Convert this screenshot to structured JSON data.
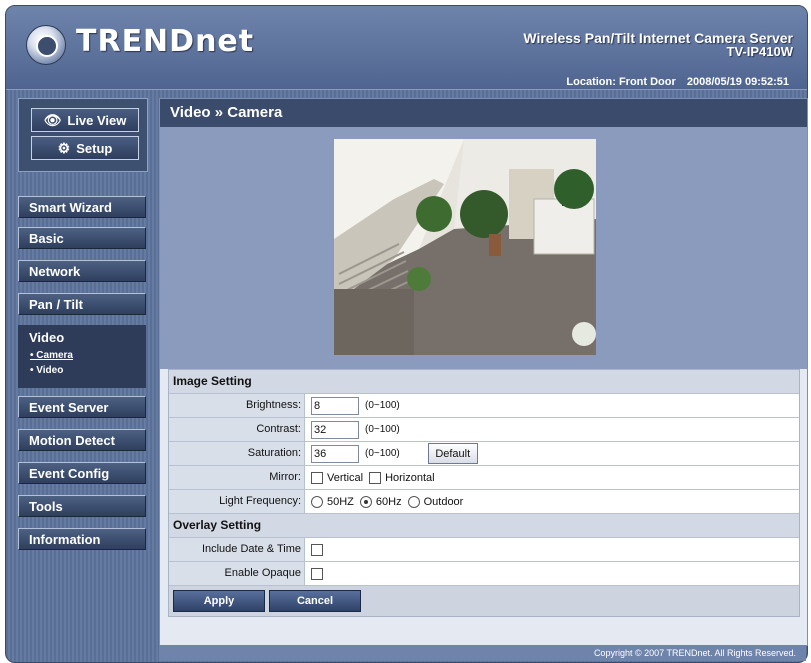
{
  "header": {
    "logo_text": "TRENDnet",
    "product_title": "Wireless Pan/Tilt Internet Camera Server",
    "product_model": "TV-IP410W",
    "location": "Location: Front Door",
    "datetime": "2008/05/19 09:52:51"
  },
  "mode": {
    "live_view": "Live View",
    "setup": "Setup"
  },
  "nav": {
    "items": [
      "Smart Wizard",
      "Basic",
      "Network",
      "Pan / Tilt",
      "Video",
      "Event Server",
      "Motion Detect",
      "Event Config",
      "Tools",
      "Information"
    ],
    "sub_items": [
      "• Camera",
      "• Video"
    ]
  },
  "main": {
    "title": "Video » Camera",
    "image_setting": {
      "header": "Image Setting",
      "brightness_label": "Brightness:",
      "brightness_value": "8",
      "brightness_range": "(0~100)",
      "contrast_label": "Contrast:",
      "contrast_value": "32",
      "contrast_range": "(0~100)",
      "saturation_label": "Saturation:",
      "saturation_value": "36",
      "saturation_range": "(0~100)",
      "default_button": "Default",
      "mirror_label": "Mirror:",
      "mirror_vertical": "Vertical",
      "mirror_horizontal": "Horizontal",
      "light_freq_label": "Light Frequency:",
      "freq_50": "50HZ",
      "freq_60": "60Hz",
      "freq_outdoor": "Outdoor"
    },
    "overlay_setting": {
      "header": "Overlay Setting",
      "include_date_label": "Include Date & Time",
      "enable_opaque_label": "Enable Opaque"
    },
    "apply_button": "Apply",
    "cancel_button": "Cancel"
  },
  "footer": {
    "copyright": "Copyright © 2007 TRENDnet. All Rights Reserved."
  },
  "colors": {
    "accent": "#3b4b6b",
    "frame": "#5a6f96"
  }
}
